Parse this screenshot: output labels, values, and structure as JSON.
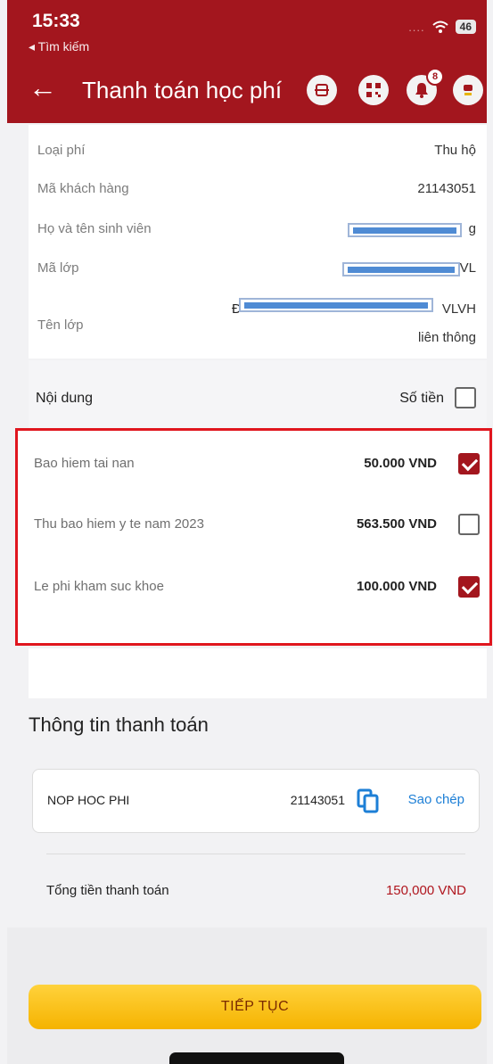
{
  "status_bar": {
    "time": "15:33",
    "back_app": "◂ Tìm kiếm",
    "battery": "46"
  },
  "header": {
    "title": "Thanh toán học phí",
    "notification_count": "8"
  },
  "info": {
    "fee_type_label": "Loại phí",
    "fee_type_value": "Thu hộ",
    "customer_code_label": "Mã khách hàng",
    "customer_code_value": "21143051",
    "student_name_label": "Họ và tên sinh viên",
    "student_name_tail": "g",
    "class_code_label": "Mã lớp",
    "class_code_tail": "VL",
    "class_name_label": "Tên lớp",
    "class_name_head": "Đ",
    "class_name_tail": "VLVH",
    "class_name_line2": "liên thông"
  },
  "content": {
    "label": "Nội dung",
    "amount_label": "Số tiền",
    "select_all": false
  },
  "fees": [
    {
      "name": "Bao hiem tai nan",
      "amount": "50.000 VND",
      "checked": true
    },
    {
      "name": "Thu bao hiem y te nam 2023",
      "amount": "563.500 VND",
      "checked": false
    },
    {
      "name": "Le phi kham suc khoe",
      "amount": "100.000 VND",
      "checked": true
    }
  ],
  "payment": {
    "title": "Thông tin thanh toán",
    "description": "NOP HOC PHI",
    "code": "21143051",
    "copy_label": "Sao chép",
    "total_label": "Tổng tiền thanh toán",
    "total_value": "150,000 VND"
  },
  "continue_label": "TIẾP TỤC",
  "colors": {
    "brand": "#a3161e",
    "highlight_border": "#e0161e",
    "link": "#1d7fd6",
    "button": "#f5b300"
  }
}
